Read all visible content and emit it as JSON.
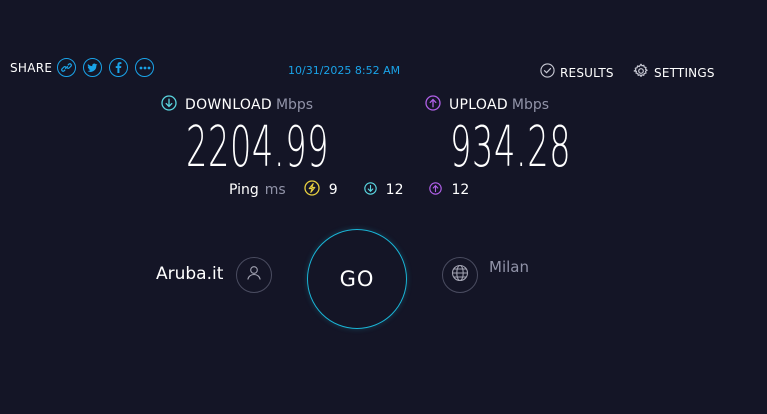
{
  "colors": {
    "background": "#141526",
    "accent_blue": "#1aa3e8",
    "download": "#5ad6e0",
    "upload": "#b060e8",
    "ping": "#e8d040",
    "muted": "#9193a8"
  },
  "header": {
    "share_label": "SHARE",
    "share_icons": [
      "link-icon",
      "twitter-icon",
      "facebook-icon",
      "more-icon"
    ],
    "timestamp": "10/31/2025 8:52 AM",
    "results_label": "RESULTS",
    "settings_label": "SETTINGS"
  },
  "download": {
    "label": "DOWNLOAD",
    "unit": "Mbps",
    "value": "2204.99"
  },
  "upload": {
    "label": "UPLOAD",
    "unit": "Mbps",
    "value": "934.28"
  },
  "ping": {
    "label": "Ping",
    "unit": "ms",
    "idle": "9",
    "download": "12",
    "upload": "12"
  },
  "isp": {
    "name": "Aruba.it"
  },
  "server": {
    "location": "Milan"
  },
  "go_button": {
    "label": "GO"
  }
}
